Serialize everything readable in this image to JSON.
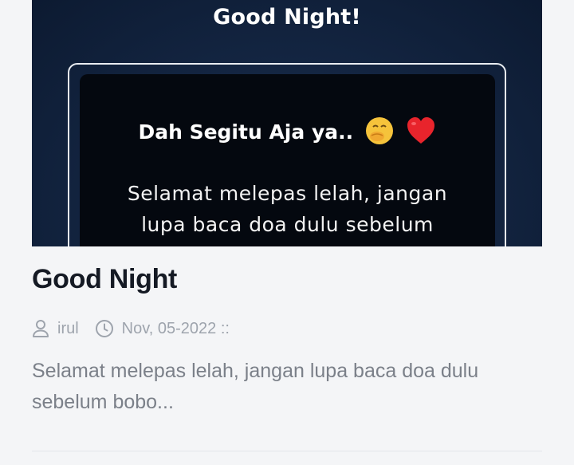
{
  "post": {
    "image": {
      "title": "Good Night!",
      "heading": "Dah Segitu Aja ya..",
      "body_line_1": "Selamat melepas lelah, jangan",
      "body_line_2": "lupa baca doa dulu sebelum",
      "emojis": [
        "hand-over-mouth-emoji",
        "red-heart-emoji"
      ]
    },
    "title": "Good Night",
    "author": "irul",
    "date": "Nov, 05-2022 ::",
    "excerpt": "Selamat melepas lelah, jangan lupa baca doa dulu sebelum bobo..."
  },
  "colors": {
    "page_background": "#f4f5f7",
    "title_text": "#151a24",
    "meta_text": "#9ea4ad",
    "excerpt_text": "#7b8089",
    "image_background": "#142643"
  }
}
